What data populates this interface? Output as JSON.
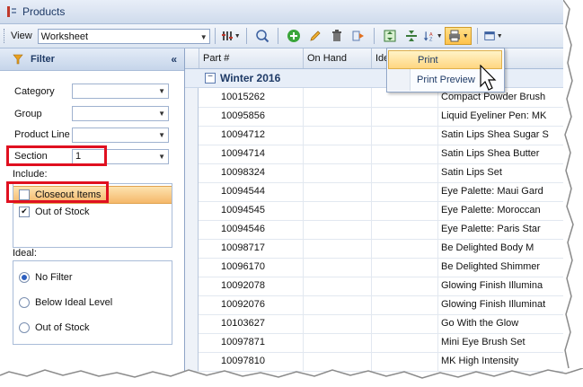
{
  "window": {
    "title": "Products"
  },
  "toolbar": {
    "view_label": "View",
    "view_value": "Worksheet",
    "icons": [
      "columns-icon",
      "search-icon",
      "add-icon",
      "edit-icon",
      "delete-icon",
      "export-icon",
      "expand-icon",
      "collapse-icon",
      "sort-icon",
      "print-icon",
      "layout-icon"
    ]
  },
  "filter": {
    "title": "Filter",
    "collapse_glyph": "«",
    "category_label": "Category",
    "group_label": "Group",
    "product_line_label": "Product Line",
    "section_label": "Section",
    "section_value": "1",
    "include_label": "Include:",
    "include_items": [
      {
        "label": "Closeout Items",
        "checked": false
      },
      {
        "label": "Out of Stock",
        "checked": true
      }
    ],
    "ideal_label": "Ideal:",
    "ideal_options": [
      {
        "label": "No Filter",
        "selected": true
      },
      {
        "label": "Below Ideal Level",
        "selected": false
      },
      {
        "label": "Out of Stock",
        "selected": false
      }
    ]
  },
  "grid": {
    "columns": [
      "Part #",
      "On Hand",
      "Ide",
      ""
    ],
    "group_title": "Winter 2016",
    "rows": [
      {
        "part": "10015262",
        "desc": "Compact Powder Brush"
      },
      {
        "part": "10095856",
        "desc": "Liquid Eyeliner Pen: MK"
      },
      {
        "part": "10094712",
        "desc": "Satin Lips Shea Sugar S"
      },
      {
        "part": "10094714",
        "desc": "Satin Lips Shea Butter"
      },
      {
        "part": "10098324",
        "desc": "Satin Lips Set"
      },
      {
        "part": "10094544",
        "desc": "Eye Palette: Maui Gard"
      },
      {
        "part": "10094545",
        "desc": "Eye Palette: Moroccan"
      },
      {
        "part": "10094546",
        "desc": "Eye Palette: Paris Star"
      },
      {
        "part": "10098717",
        "desc": "Be Delighted Body M"
      },
      {
        "part": "10096170",
        "desc": "Be Delighted Shimmer"
      },
      {
        "part": "10092078",
        "desc": "Glowing Finish Illumina"
      },
      {
        "part": "10092076",
        "desc": "Glowing Finish Illuminat"
      },
      {
        "part": "10103627",
        "desc": "Go With the Glow"
      },
      {
        "part": "10097871",
        "desc": "Mini Eye Brush Set"
      },
      {
        "part": "10097810",
        "desc": "MK High Intensity"
      }
    ]
  },
  "print_menu": {
    "items": [
      "Print",
      "Print Preview"
    ]
  },
  "colors": {
    "highlight_box": "#e01020",
    "accent": "#1e3a66"
  }
}
